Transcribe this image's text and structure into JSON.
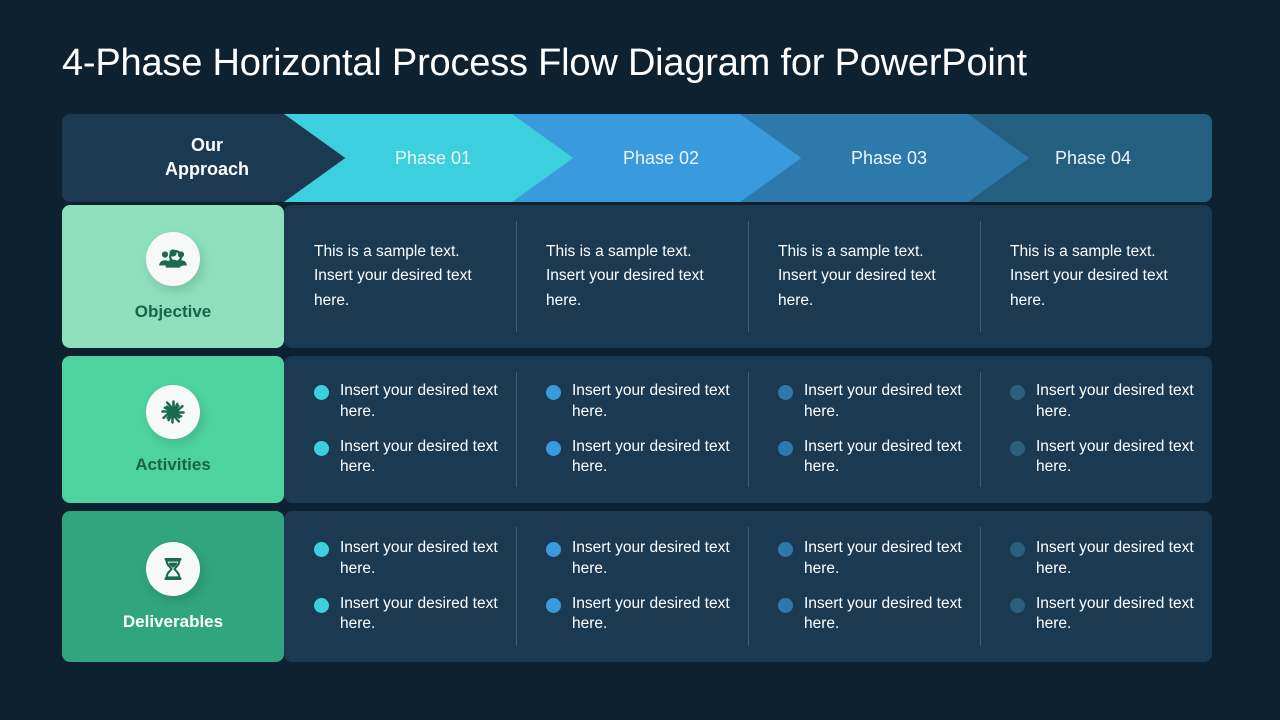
{
  "title": "4-Phase Horizontal Process Flow Diagram for PowerPoint",
  "header": {
    "approach_label_line1": "Our",
    "approach_label_line2": "Approach",
    "phases": [
      {
        "label": "Phase 01",
        "color": "#3ccfdd"
      },
      {
        "label": "Phase 02",
        "color": "#3a9ade"
      },
      {
        "label": "Phase 03",
        "color": "#2e79ab"
      },
      {
        "label": "Phase 04",
        "color": "#245f80"
      }
    ]
  },
  "rows": [
    {
      "label": "Objective",
      "icon": "audience-research-icon",
      "tile_color": "#8ddfbe",
      "cells": [
        {
          "text": "This is a sample text. Insert your desired text here."
        },
        {
          "text": "This is a sample text. Insert your desired text here."
        },
        {
          "text": "This is a sample text. Insert your desired text here."
        },
        {
          "text": "This is a sample text. Insert your desired text here."
        }
      ]
    },
    {
      "label": "Activities",
      "icon": "teamwork-hands-icon",
      "tile_color": "#4ed3a0",
      "cells": [
        {
          "bullets": [
            "Insert your desired text here.",
            "Insert your desired text here."
          ]
        },
        {
          "bullets": [
            "Insert your desired text here.",
            "Insert your desired text here."
          ]
        },
        {
          "bullets": [
            "Insert your desired text here.",
            "Insert your desired text here."
          ]
        },
        {
          "bullets": [
            "Insert your desired text here.",
            "Insert your desired text here."
          ]
        }
      ]
    },
    {
      "label": "Deliverables",
      "icon": "hourglass-icon",
      "tile_color": "#30a57e",
      "cells": [
        {
          "bullets": [
            "Insert your desired text here.",
            "Insert your desired text here."
          ]
        },
        {
          "bullets": [
            "Insert your desired text here.",
            "Insert your desired text here."
          ]
        },
        {
          "bullets": [
            "Insert your desired text here.",
            "Insert your desired text here."
          ]
        },
        {
          "bullets": [
            "Insert your desired text here.",
            "Insert your desired text here."
          ]
        }
      ]
    }
  ],
  "colors": {
    "background": "#0e2131",
    "panel": "#1b3a52",
    "approach_cell": "#1b3a52"
  }
}
